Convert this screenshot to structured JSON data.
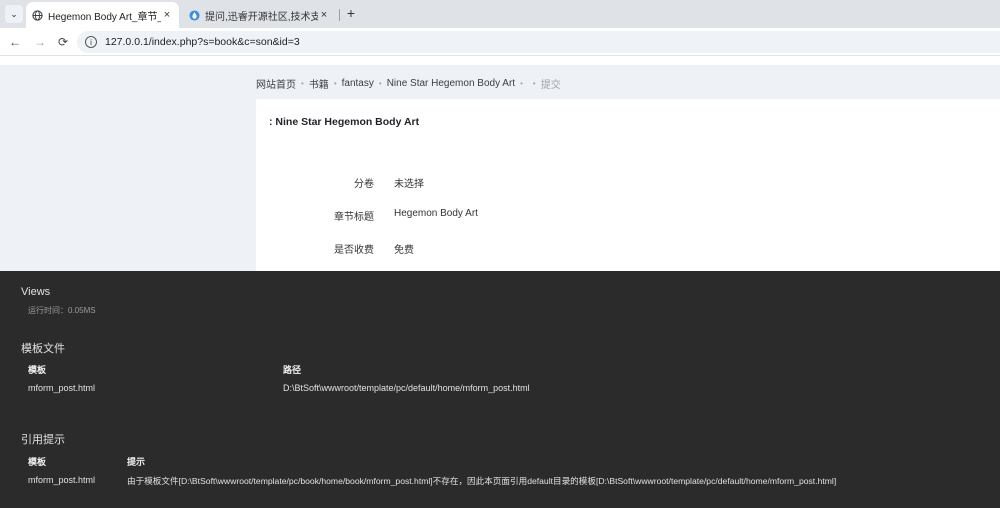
{
  "browser": {
    "tabs": [
      {
        "title": "Hegemon Body Art_章节_Nc",
        "active": true,
        "favicon": "globe-icon"
      },
      {
        "title": "提问,迅睿开源社区,技术支持,Ci",
        "active": false,
        "favicon": "droplet-icon"
      }
    ],
    "tab_close_glyph": "×",
    "new_tab_glyph": "+",
    "tab_menu_glyph": "⌄",
    "url": "127.0.0.1/index.php?s=book&c=son&id=3",
    "nav": {
      "back": "←",
      "forward": "→",
      "reload": "⟳",
      "info": "i"
    }
  },
  "breadcrumb": {
    "items": [
      "网站首页",
      "书籍",
      "fantasy",
      "Nine Star Hegemon Body Art",
      ""
    ],
    "current": "提交",
    "separator": "•"
  },
  "form": {
    "title": ": Nine Star Hegemon Body Art",
    "rows": [
      {
        "label": "分卷",
        "value": "未选择"
      },
      {
        "label": "章节标题",
        "value": "Hegemon Body Art"
      },
      {
        "label": "是否收费",
        "value": "免费"
      }
    ]
  },
  "debug": {
    "views_title": "Views",
    "runtime": "运行时间：0.05MS",
    "template_section": {
      "title": "模板文件",
      "headers": [
        "模板",
        "路径"
      ],
      "rows": [
        [
          "mform_post.html",
          "D:\\BtSoft\\wwwroot/template/pc/default/home/mform_post.html"
        ]
      ]
    },
    "hint_section": {
      "title": "引用提示",
      "headers": [
        "模板",
        "提示"
      ],
      "rows": [
        [
          "mform_post.html",
          "由于模板文件[D:\\BtSoft\\wwwroot/template/pc/book/home/book/mform_post.html]不存在，因此本页面引用default目录的模板[D:\\BtSoft\\wwwroot/template/pc/default/home/mform_post.html]"
        ]
      ]
    }
  },
  "colors": {
    "tabstrip": "#dfe3e8",
    "page_bg": "#eef1f5",
    "debug_bg": "#2b2b2b"
  }
}
